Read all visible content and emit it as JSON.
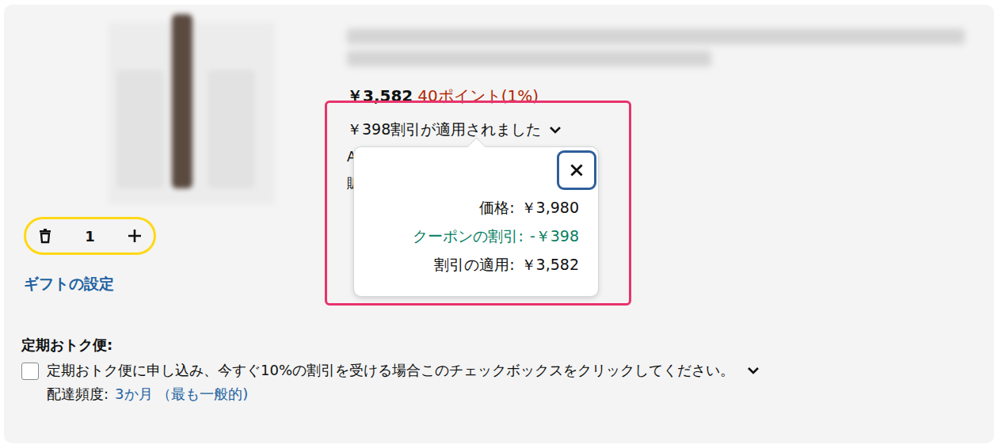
{
  "item": {
    "price": "￥3,582",
    "points": "40ポイント(1%)",
    "discount_toggle": "￥398割引が適用されました",
    "discount_expanded": true,
    "ships_from": "Amazon Japan G.K. から発送",
    "seller": "販"
  },
  "quantity": {
    "value": "1"
  },
  "gift_link": "ギフトの設定",
  "popover": {
    "rows": [
      {
        "label": "価格:",
        "value": "￥3,980",
        "kind": "normal"
      },
      {
        "label": "クーポンの割引:",
        "value": "-￥398",
        "kind": "discount"
      },
      {
        "label": "割引の適用:",
        "value": "￥3,582",
        "kind": "normal"
      }
    ]
  },
  "subscribe": {
    "title": "定期おトク便:",
    "checked": false,
    "text": "定期おトク便に申し込み、今すぐ10%の割引を受ける場合このチェックボックスをクリックしてください。",
    "frequency_label": "配達頻度:",
    "frequency_value": "3か月",
    "frequency_note": "（最も一般的)"
  }
}
